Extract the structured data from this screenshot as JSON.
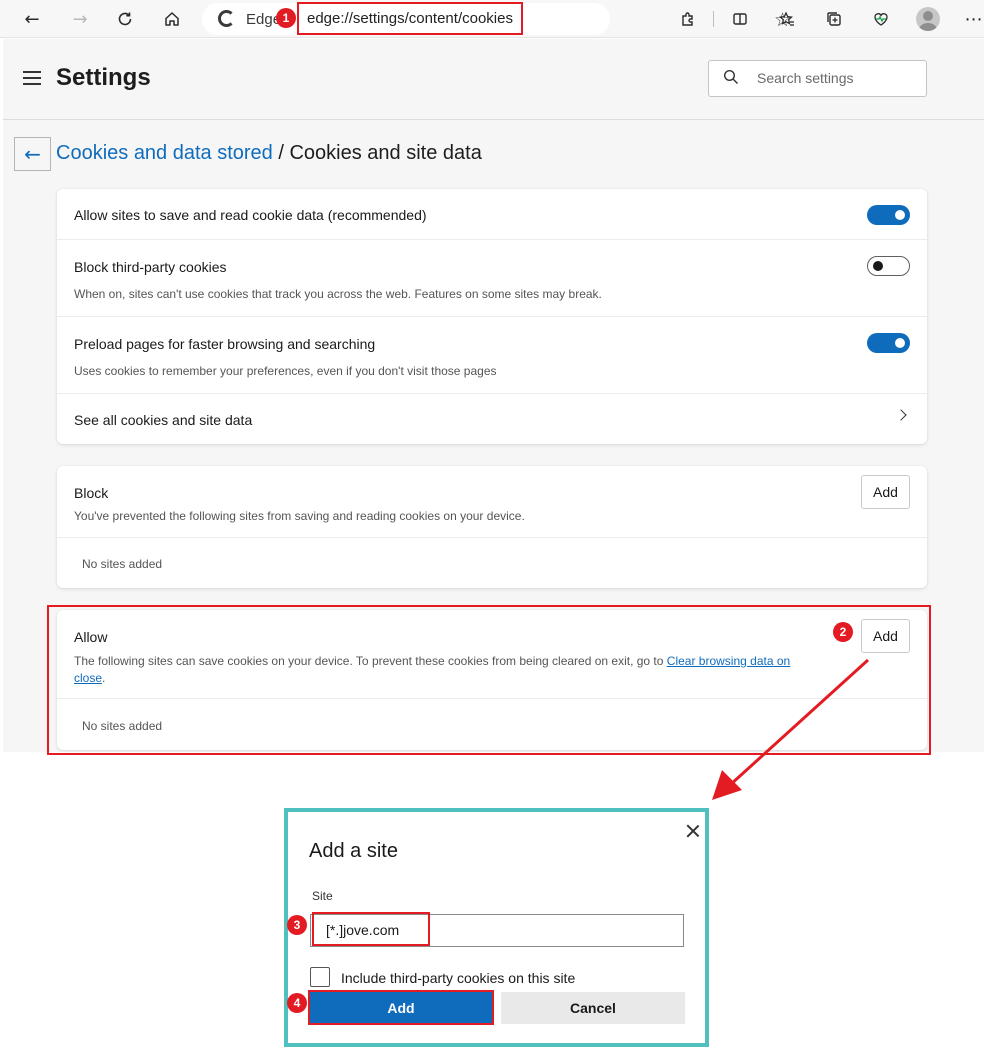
{
  "browser": {
    "tab_label": "Edge",
    "url": "edge://settings/content/cookies",
    "icons": [
      "back-icon",
      "forward-icon",
      "refresh-icon",
      "home-icon",
      "favorite-star-icon",
      "extensions-icon",
      "split-screen-icon",
      "favorites-icon",
      "collections-icon",
      "browser-essentials-icon",
      "profile-avatar-icon",
      "more-icon"
    ]
  },
  "settings": {
    "title": "Settings",
    "search_placeholder": "Search settings"
  },
  "breadcrumb": {
    "parent": "Cookies and data stored",
    "separator": " / ",
    "current": "Cookies and site data"
  },
  "cookie_options": [
    {
      "title": "Allow sites to save and read cookie data (recommended)",
      "description": "",
      "enabled": true
    },
    {
      "title": "Block third-party cookies",
      "description": "When on, sites can't use cookies that track you across the web. Features on some sites may break.",
      "enabled": false
    },
    {
      "title": "Preload pages for faster browsing and searching",
      "description": "Uses cookies to remember your preferences, even if you don't visit those pages",
      "enabled": true
    },
    {
      "title": "See all cookies and site data"
    }
  ],
  "block": {
    "title": "Block",
    "description": "You've prevented the following sites from saving and reading cookies on your device.",
    "add_label": "Add",
    "empty": "No sites added"
  },
  "allow": {
    "title": "Allow",
    "description_prefix": "The following sites can save cookies on your device. To prevent these cookies from being cleared on exit, go to ",
    "link_part1": "Clear browsing data on",
    "link_part2": "close",
    "description_suffix": ".",
    "add_label": "Add",
    "empty": "No sites added"
  },
  "dialog": {
    "title": "Add a site",
    "site_label": "Site",
    "site_value": "[*.]jove.com",
    "checkbox_label": "Include third-party cookies on this site",
    "checkbox_checked": false,
    "add_label": "Add",
    "cancel_label": "Cancel"
  },
  "steps": [
    "1",
    "2",
    "3",
    "4"
  ],
  "colors": {
    "accent": "#0f6cbd",
    "annotation_red": "#e31b23",
    "dialog_border": "#4fbfbf"
  }
}
